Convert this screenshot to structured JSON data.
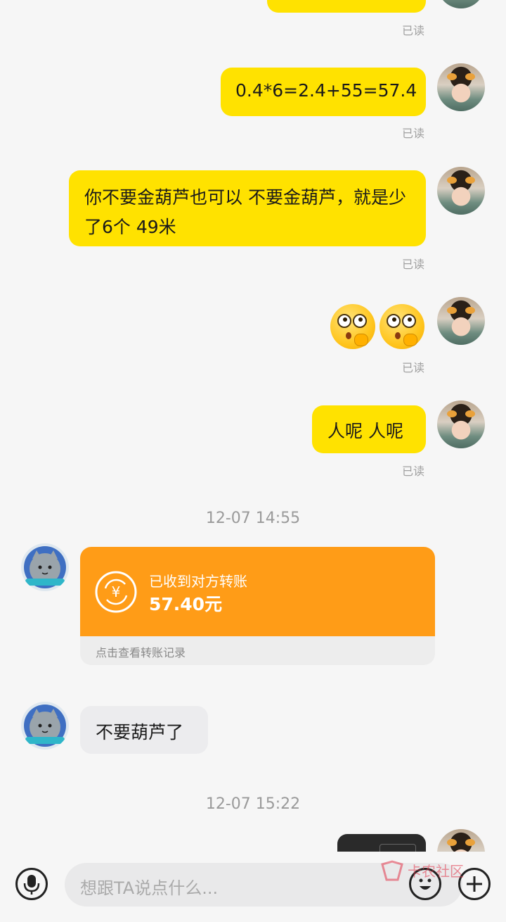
{
  "messages": {
    "read_label": "已读",
    "m1_text": "0.4*6=2.4+55=57.4",
    "m2_text": "你不要金葫芦也可以  不要金葫芦，就是少了6个  49米",
    "m4_text": "人呢  人呢",
    "m6_text": "不要葫芦了"
  },
  "timestamps": {
    "t1": "12-07 14:55",
    "t2": "12-07 15:22"
  },
  "transfer": {
    "title": "已收到对方转账",
    "amount": "57.40元",
    "footer": "点击查看转账记录",
    "icon": "yuan-exchange-icon",
    "color": "#ff9c17"
  },
  "input": {
    "placeholder": "想跟TA说点什么..."
  },
  "watermark": {
    "text": "卡农社区"
  },
  "colors": {
    "bubble_self": "#ffe200",
    "bubble_other": "#ececee",
    "background": "#f6f6f6"
  }
}
